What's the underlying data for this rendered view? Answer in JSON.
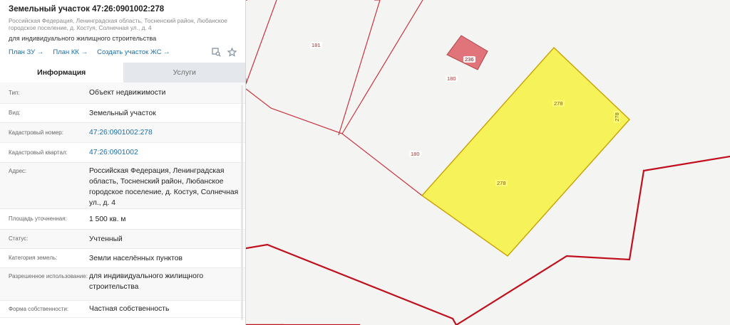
{
  "header": {
    "title": "Земельный участок 47:26:0901002:278",
    "address": "Российская Федерация, Ленинградская область, Тосненский район, Любанское городское поселение, д. Костуя, Солнечная ул., д. 4",
    "purpose": "для индивидуального жилищного строительства"
  },
  "actions": [
    {
      "label": "План ЗУ",
      "arrow": "→"
    },
    {
      "label": "План КК",
      "arrow": "→"
    },
    {
      "label": "Создать участок ЖС",
      "arrow": "→"
    }
  ],
  "icons": {
    "find": "locate-icon",
    "favorite": "star-icon"
  },
  "tabs": [
    {
      "label": "Информация",
      "active": true
    },
    {
      "label": "Услуги",
      "active": false
    }
  ],
  "rows": [
    {
      "label": "Тип:",
      "value": "Объект недвижимости",
      "link": false
    },
    {
      "label": "Вид:",
      "value": "Земельный участок",
      "link": false
    },
    {
      "label": "Кадастровый номер:",
      "value": "47:26:0901002:278",
      "link": true
    },
    {
      "label": "Кадастровый квартал:",
      "value": "47:26:0901002",
      "link": true
    },
    {
      "label": "Адрес:",
      "value": "Российская Федерация, Ленинградская область, Тосненский район, Любанское городское поселение, д. Костуя, Солнечная ул., д. 4",
      "link": false
    },
    {
      "label": "Площадь уточненная:",
      "value": "1 500 кв. м",
      "link": false
    },
    {
      "label": "Статус:",
      "value": "Учтенный",
      "link": false
    },
    {
      "label": "Категория земель:",
      "value": "Земли населённых пунктов",
      "link": false
    },
    {
      "label": "Разрешенное использование:",
      "value": "для индивидуального жилищного строительства",
      "link": false
    },
    {
      "label": "Форма собственности:",
      "value": "Частная собственность",
      "link": false
    }
  ],
  "map": {
    "parcel_labels": {
      "p181": "181",
      "p180a": "180",
      "p180b": "180",
      "p236": "236",
      "p278a": "278",
      "p278b": "278",
      "p278c": "278"
    },
    "colors": {
      "boundary": "#c9323f",
      "highlight_fill": "#f6f25a",
      "highlight_stroke": "#c8a200",
      "building": "#e0747a",
      "zone": "#c0101e"
    }
  }
}
